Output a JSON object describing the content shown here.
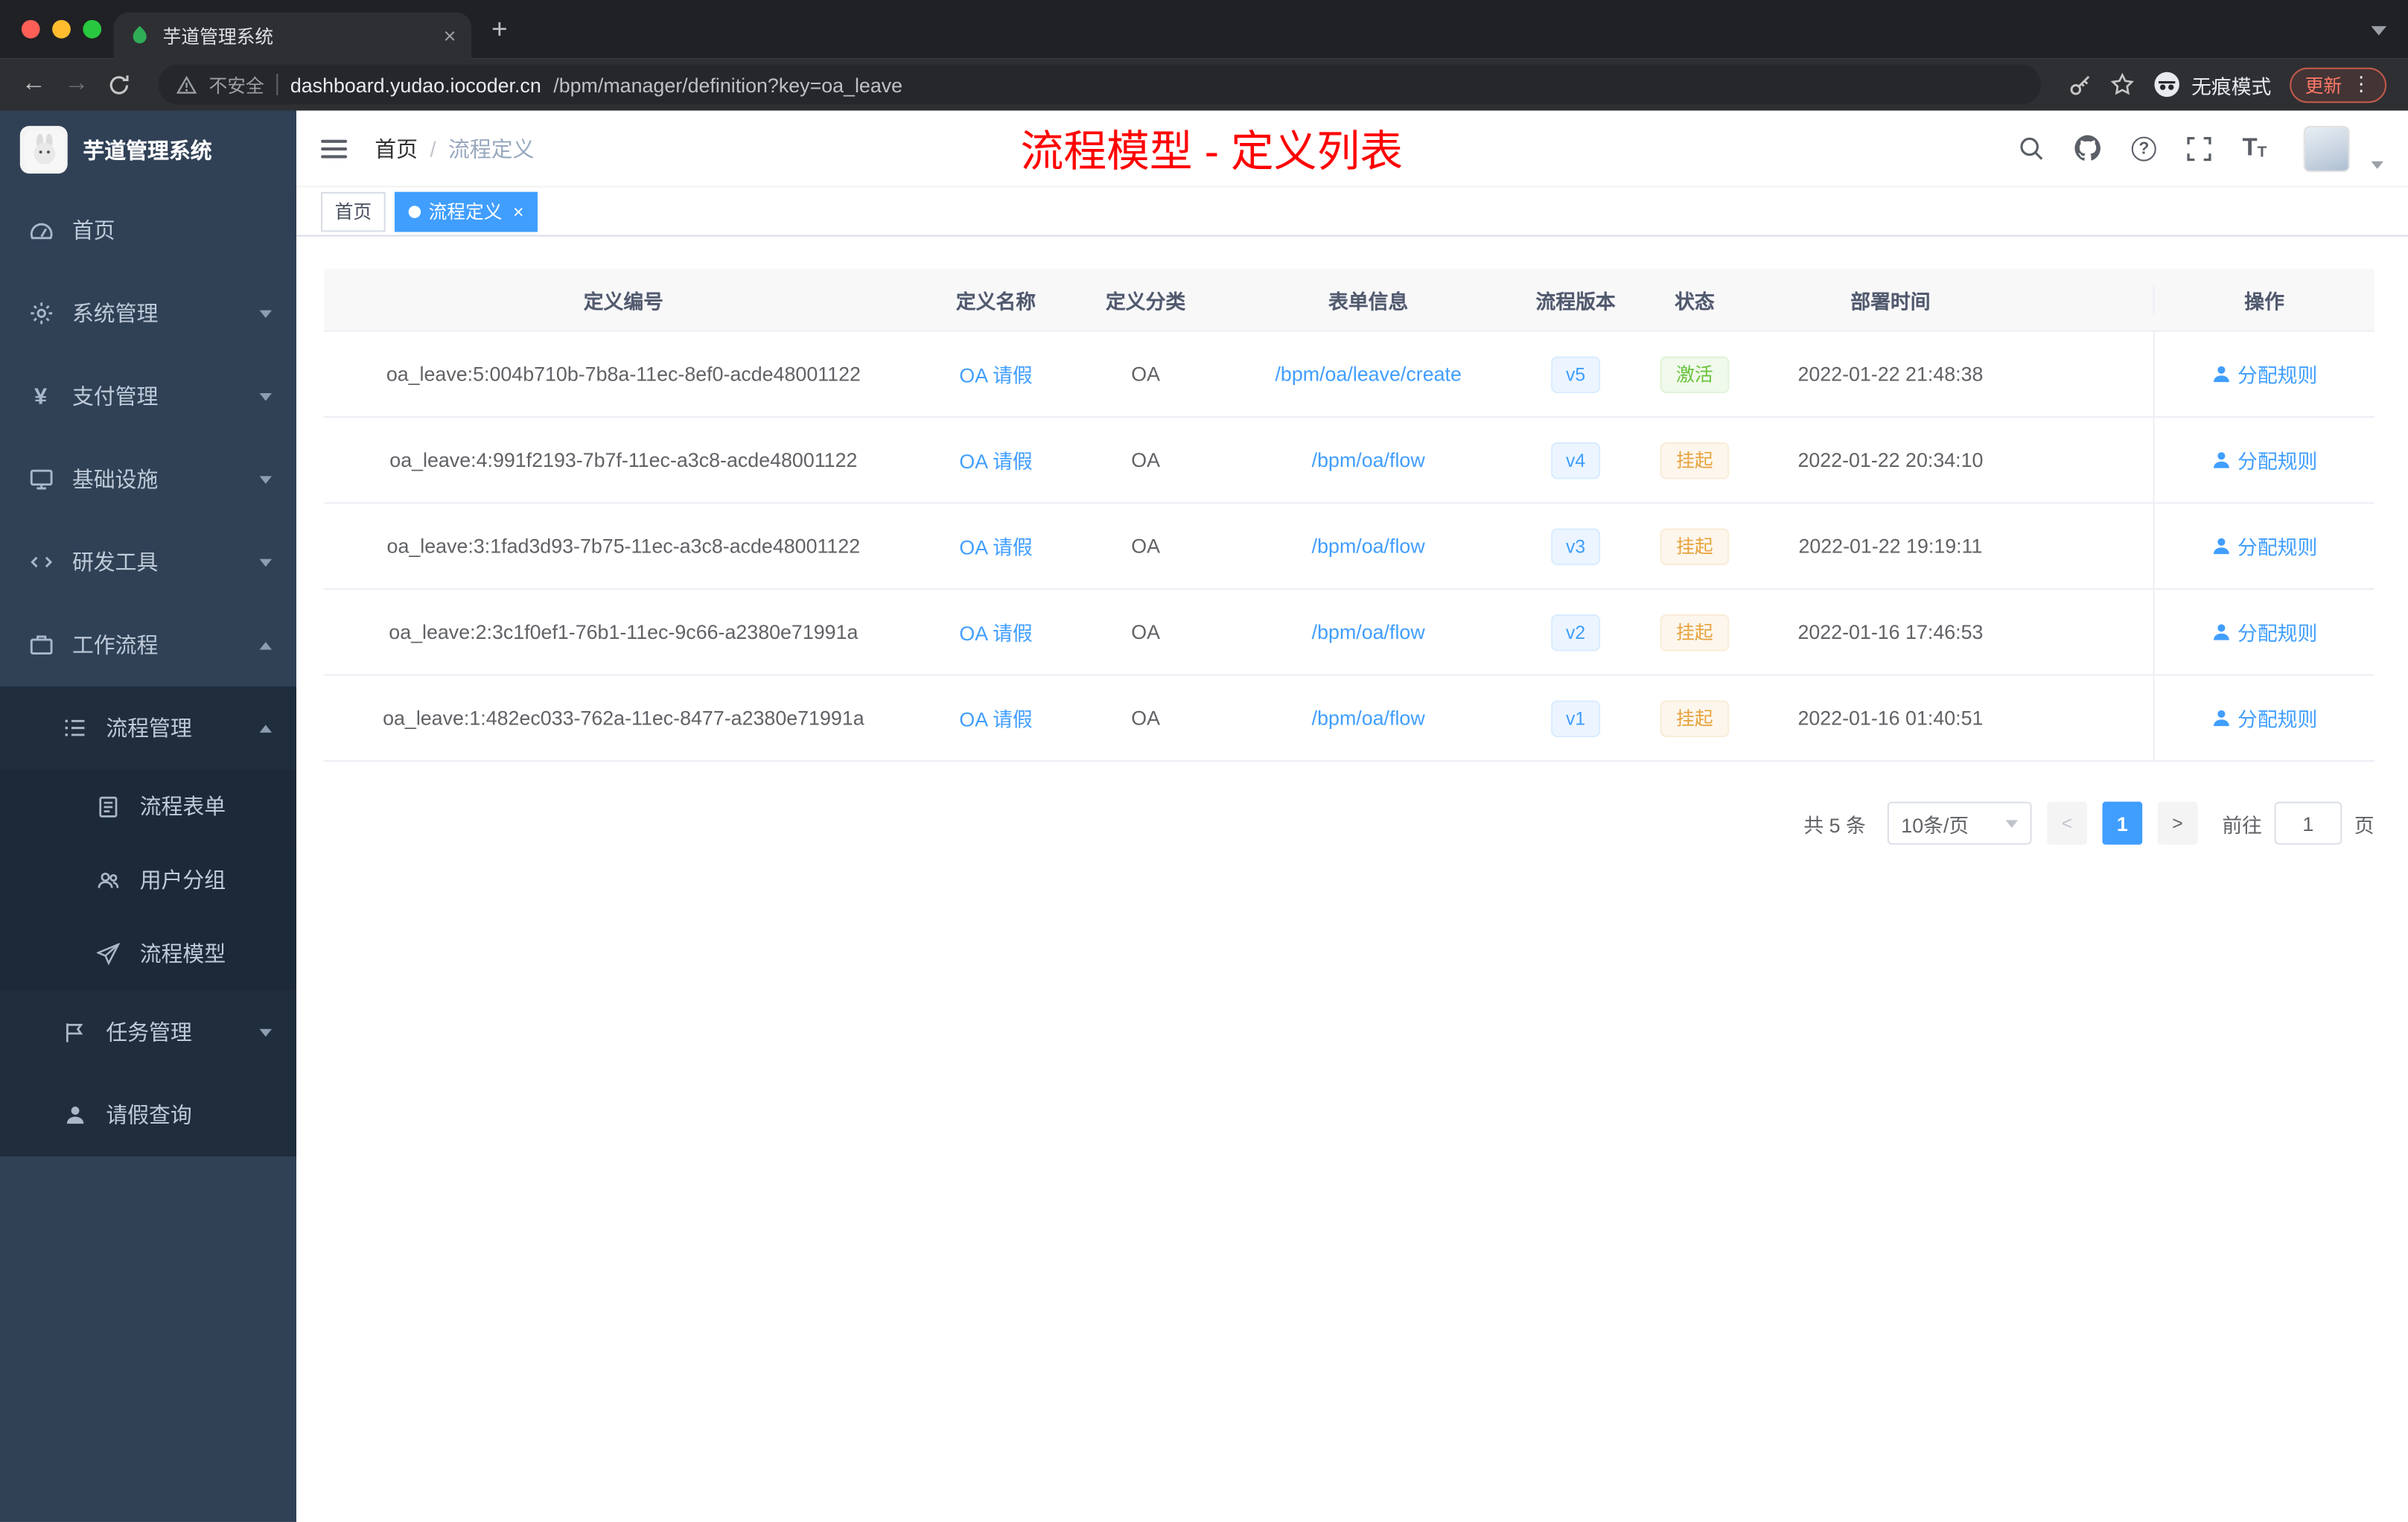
{
  "browser": {
    "tab_title": "芋道管理系统",
    "security_label": "不安全",
    "url_domain": "dashboard.yudao.iocoder.cn",
    "url_path": "/bpm/manager/definition?key=oa_leave",
    "incognito_label": "无痕模式",
    "update_label": "更新"
  },
  "sidebar": {
    "logo_title": "芋道管理系统",
    "items": [
      {
        "label": "首页"
      },
      {
        "label": "系统管理"
      },
      {
        "label": "支付管理"
      },
      {
        "label": "基础设施"
      },
      {
        "label": "研发工具"
      },
      {
        "label": "工作流程"
      },
      {
        "label": "流程管理"
      },
      {
        "label": "流程表单"
      },
      {
        "label": "用户分组"
      },
      {
        "label": "流程模型"
      },
      {
        "label": "任务管理"
      },
      {
        "label": "请假查询"
      }
    ]
  },
  "header": {
    "breadcrumb_home": "首页",
    "breadcrumb_sep": "/",
    "breadcrumb_current": "流程定义",
    "page_title": "流程模型 - 定义列表"
  },
  "tags": {
    "home": "首页",
    "active": "流程定义"
  },
  "table": {
    "columns": [
      "定义编号",
      "定义名称",
      "定义分类",
      "表单信息",
      "流程版本",
      "状态",
      "部署时间",
      "操作"
    ],
    "rows": [
      {
        "id": "oa_leave:5:004b710b-7b8a-11ec-8ef0-acde48001122",
        "name": "OA 请假",
        "category": "OA",
        "form": "/bpm/oa/leave/create",
        "version": "v5",
        "status": "激活",
        "time": "2022-01-22 21:48:38",
        "action": "分配规则"
      },
      {
        "id": "oa_leave:4:991f2193-7b7f-11ec-a3c8-acde48001122",
        "name": "OA 请假",
        "category": "OA",
        "form": "/bpm/oa/flow",
        "version": "v4",
        "status": "挂起",
        "time": "2022-01-22 20:34:10",
        "action": "分配规则"
      },
      {
        "id": "oa_leave:3:1fad3d93-7b75-11ec-a3c8-acde48001122",
        "name": "OA 请假",
        "category": "OA",
        "form": "/bpm/oa/flow",
        "version": "v3",
        "status": "挂起",
        "time": "2022-01-22 19:19:11",
        "action": "分配规则"
      },
      {
        "id": "oa_leave:2:3c1f0ef1-76b1-11ec-9c66-a2380e71991a",
        "name": "OA 请假",
        "category": "OA",
        "form": "/bpm/oa/flow",
        "version": "v2",
        "status": "挂起",
        "time": "2022-01-16 17:46:53",
        "action": "分配规则"
      },
      {
        "id": "oa_leave:1:482ec033-762a-11ec-8477-a2380e71991a",
        "name": "OA 请假",
        "category": "OA",
        "form": "/bpm/oa/flow",
        "version": "v1",
        "status": "挂起",
        "time": "2022-01-16 01:40:51",
        "action": "分配规则"
      }
    ]
  },
  "pagination": {
    "total": "共 5 条",
    "page_size": "10条/页",
    "current_page": "1",
    "goto_label": "前往",
    "goto_value": "1",
    "unit_label": "页"
  },
  "colors": {
    "accent": "#409eff",
    "success": "#67c23a",
    "warning": "#e6a23c",
    "title_red": "#ff0000",
    "sidebar_bg": "#304156"
  }
}
